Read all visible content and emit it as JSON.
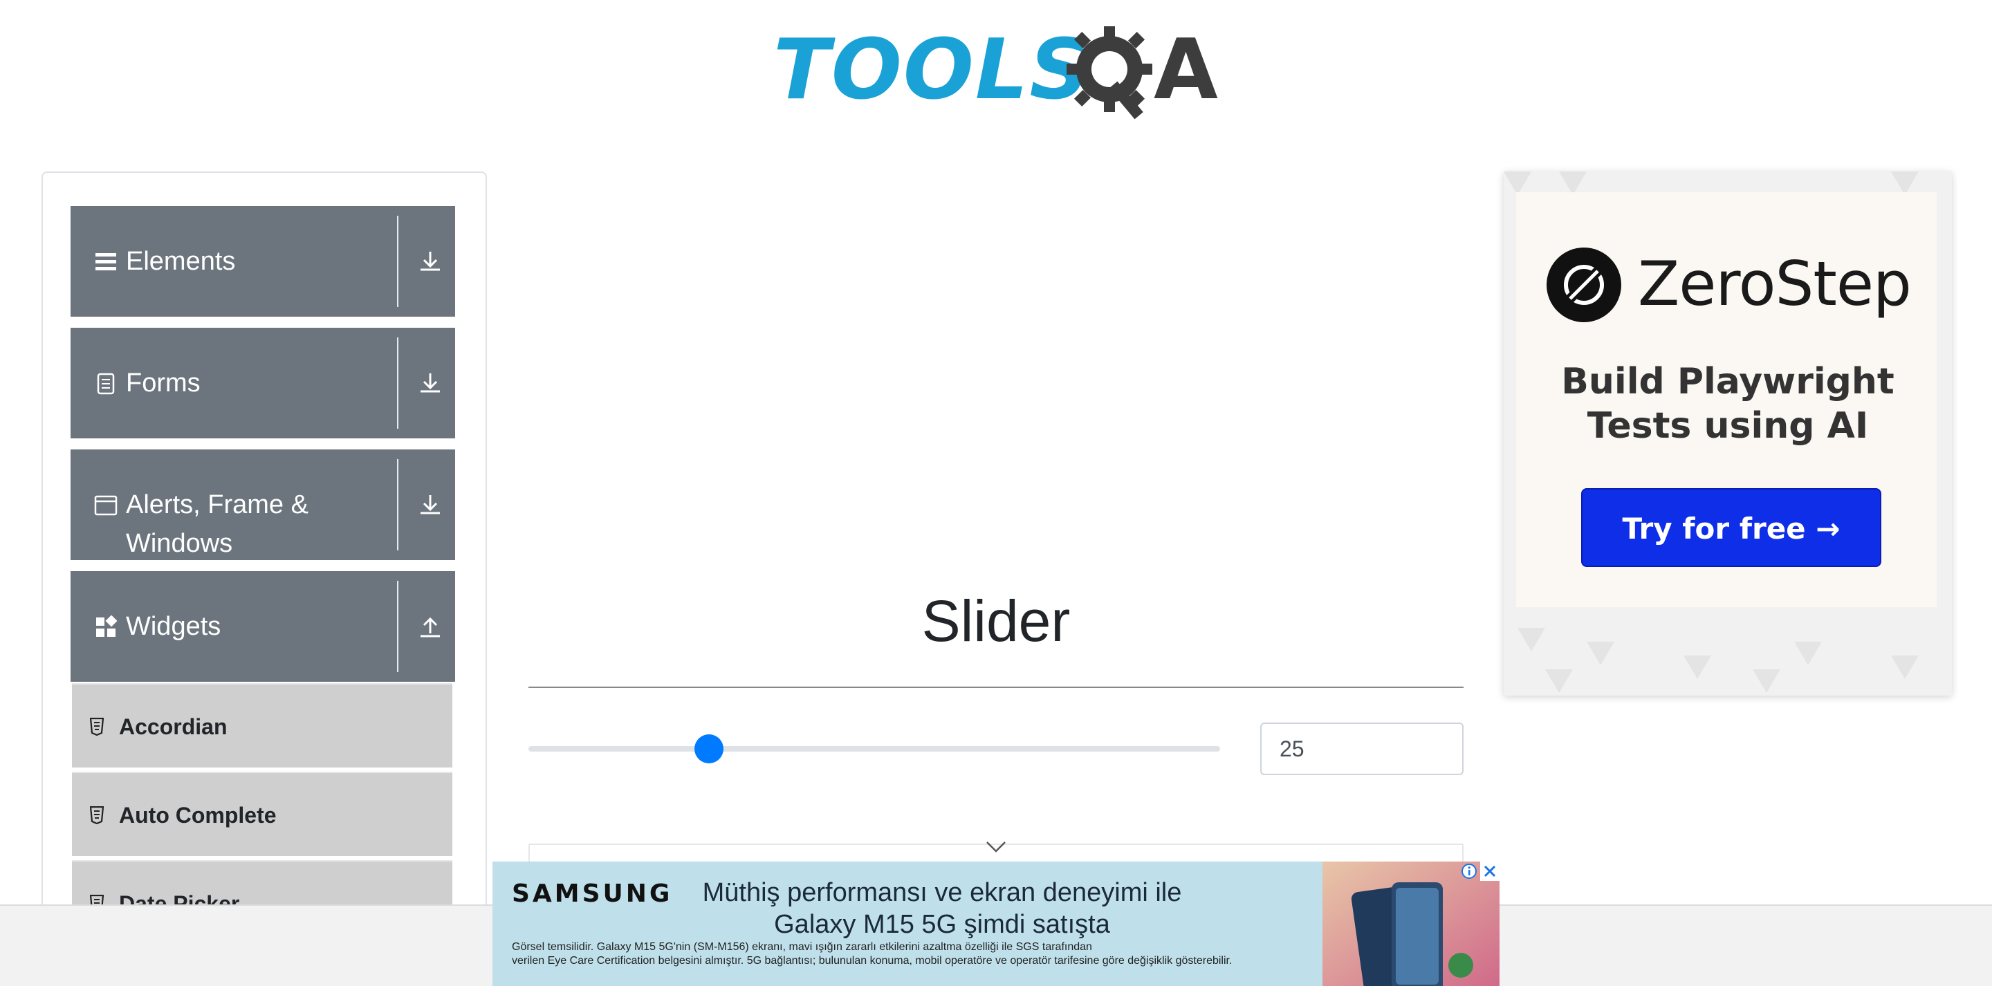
{
  "logo": {
    "text": "TOOLS",
    "suffix": "A",
    "colors": {
      "tools": "#1aa2d6",
      "gear": "#3d3d3d"
    }
  },
  "sidebar": {
    "groups": [
      {
        "label": "Elements",
        "icon": "hamburger-icon",
        "expanded": false
      },
      {
        "label": "Forms",
        "icon": "document-icon",
        "expanded": false
      },
      {
        "label": "Alerts, Frame &",
        "label2": "Windows",
        "icon": "window-icon",
        "expanded": false
      },
      {
        "label": "Widgets",
        "icon": "widgets-icon",
        "expanded": true
      }
    ],
    "widget_items": [
      "Accordian",
      "Auto Complete",
      "Date Picker"
    ]
  },
  "main": {
    "title": "Slider",
    "slider": {
      "value": "25",
      "min": 0,
      "max": 100,
      "accent": "#007bff"
    }
  },
  "ad_right": {
    "brand": "ZeroStep",
    "tagline_line1": "Build Playwright",
    "tagline_line2": "Tests using AI",
    "cta": "Try for free →",
    "cta_color": "#0e2ee8"
  },
  "ad_bottom": {
    "brand": "SAMSUNG",
    "headline_line1": "Müthiş performansı ve ekran deneyimi ile",
    "headline_line2": "Galaxy M15 5G şimdi satışta",
    "fine_line1": "Görsel temsilidir. Galaxy M15 5G'nin (SM-M156) ekranı, mavi ışığın zararlı etkilerini azaltma özelliği ile SGS tarafından",
    "fine_line2": "verilen Eye Care Certification belgesini almıştır. 5G bağlantısı; bulunulan konuma, mobil operatöre ve operatör tarifesine göre değişiklik gösterebilir."
  }
}
